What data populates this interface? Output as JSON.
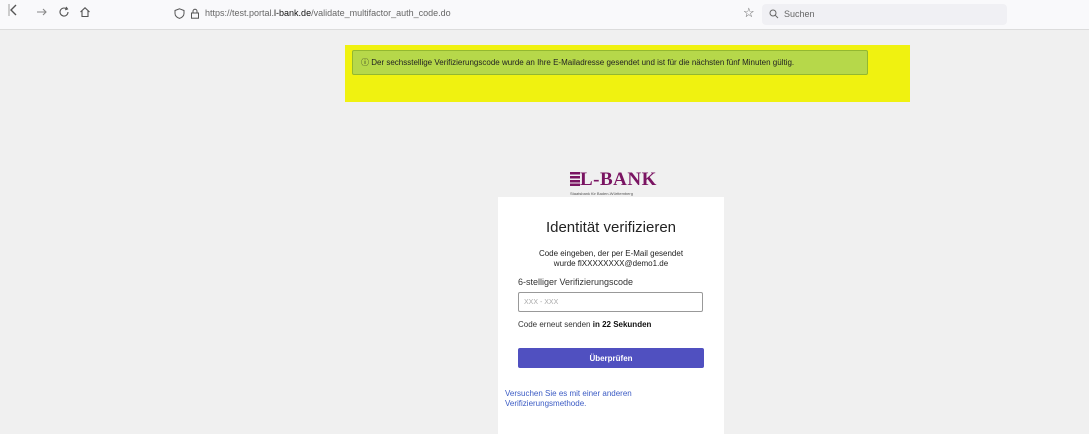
{
  "browser": {
    "url_prefix": "https://test.portal.",
    "url_domain": "l-bank.de",
    "url_path": "/validate_multifactor_auth_code.do",
    "search_placeholder": "Suchen"
  },
  "notice": {
    "icon": "info-circle-icon",
    "text": "ⓘ Der sechsstellige Verifizierungscode wurde an Ihre E-Mailadresse gesendet und ist für die nächsten fünf Minuten gültig."
  },
  "brand": {
    "name": "L-BANK",
    "tagline": "Staatsbank für Baden-Württemberg",
    "color": "#7a1462"
  },
  "card": {
    "title": "Identität verifizieren",
    "desc_line1": "Code eingeben, der per E-Mail gesendet",
    "desc_line2": "wurde flXXXXXXXX@demo1.de",
    "field_label": "6-stelliger Verifizierungscode",
    "field_placeholder": "XXX - XXX",
    "resend_prefix": "Code erneut senden ",
    "resend_timer": "in 22 Sekunden",
    "verify_label": "Überprüfen",
    "other_method": "Versuchen Sie es mit einer anderen Verifizierungsmethode."
  },
  "colors": {
    "primary_button": "#5050c0",
    "notice_bg": "#b6d84a",
    "highlight": "#f0f210",
    "link": "#3b5bc4"
  }
}
